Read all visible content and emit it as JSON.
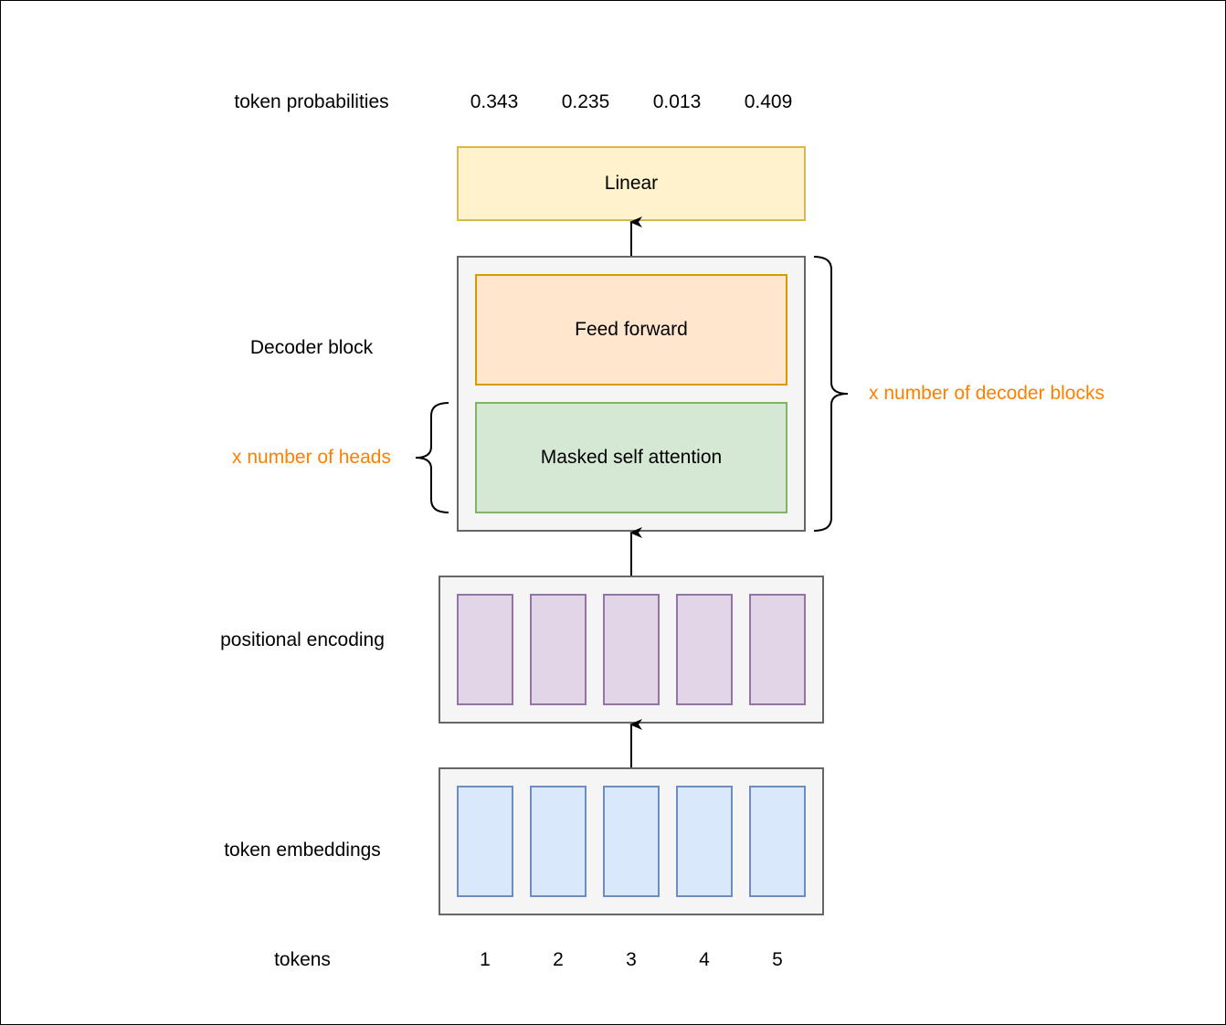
{
  "labels": {
    "token_probabilities": "token probabilities",
    "decoder_block": "Decoder block",
    "heads": "x number of heads",
    "decoder_blocks": "x number of decoder blocks",
    "positional_encoding": "positional encoding",
    "token_embeddings": "token embeddings",
    "tokens": "tokens"
  },
  "probabilities": [
    "0.343",
    "0.235",
    "0.013",
    "0.409"
  ],
  "tokens": [
    "1",
    "2",
    "3",
    "4",
    "5"
  ],
  "blocks": {
    "linear": "Linear",
    "feed_forward": "Feed forward",
    "masked_self_attention": "Masked self attention"
  },
  "colors": {
    "linear_fill": "#fff2cc",
    "linear_stroke": "#d6b656",
    "ff_fill": "#ffe6cc",
    "ff_stroke": "#d79b00",
    "attn_fill": "#d5e8d4",
    "attn_stroke": "#82b366",
    "pos_fill": "#e1d5e7",
    "pos_stroke": "#9673a6",
    "emb_fill": "#dae8fc",
    "emb_stroke": "#6c8ebf",
    "container_fill": "#f5f5f5",
    "container_stroke": "#666666",
    "annotation": "#ff8000"
  }
}
